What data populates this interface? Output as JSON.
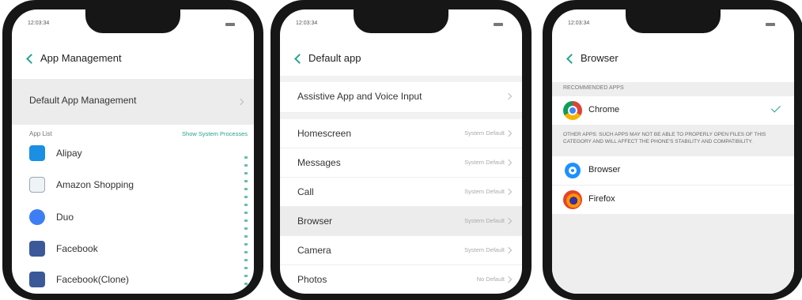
{
  "phone1": {
    "time": "12:03:34",
    "title": "App Management",
    "default_app_management": "Default App Management",
    "app_list_label": "App List",
    "show_system_processes": "Show System Processes",
    "apps": [
      {
        "label": "Alipay",
        "icon": "alipay-icon",
        "color": "#1a8fe3"
      },
      {
        "label": "Amazon Shopping",
        "icon": "amazon-icon",
        "color": "#333333"
      },
      {
        "label": "Duo",
        "icon": "duo-icon",
        "color": "#3d7ef5"
      },
      {
        "label": "Facebook",
        "icon": "facebook-icon",
        "color": "#3b5998"
      },
      {
        "label": "Facebook(Clone)",
        "icon": "facebook-icon",
        "color": "#3b5998"
      }
    ]
  },
  "phone2": {
    "time": "12:03:34",
    "title": "Default app",
    "assistive": "Assistive App and Voice Input",
    "rows": [
      {
        "label": "Homescreen",
        "value": "System Default"
      },
      {
        "label": "Messages",
        "value": "System Default"
      },
      {
        "label": "Call",
        "value": "System Default"
      },
      {
        "label": "Browser",
        "value": "System Default"
      },
      {
        "label": "Camera",
        "value": "System Default"
      },
      {
        "label": "Photos",
        "value": "No Default"
      }
    ]
  },
  "phone3": {
    "time": "12:03:34",
    "title": "Browser",
    "recommended_label": "RECOMMENDED APPS",
    "recommended_app": "Chrome",
    "other_note": "OTHER APPS: SUCH APPS MAY NOT BE ABLE TO PROPERLY OPEN FILES OF THIS CATEGORY AND WILL AFFECT THE PHONE'S STABILITY AND COMPATIBILITY.",
    "other_apps": [
      "Browser",
      "Firefox"
    ]
  },
  "colors": {
    "accent": "#27a28c",
    "highlight": "#ececec",
    "frame": "#161616"
  }
}
